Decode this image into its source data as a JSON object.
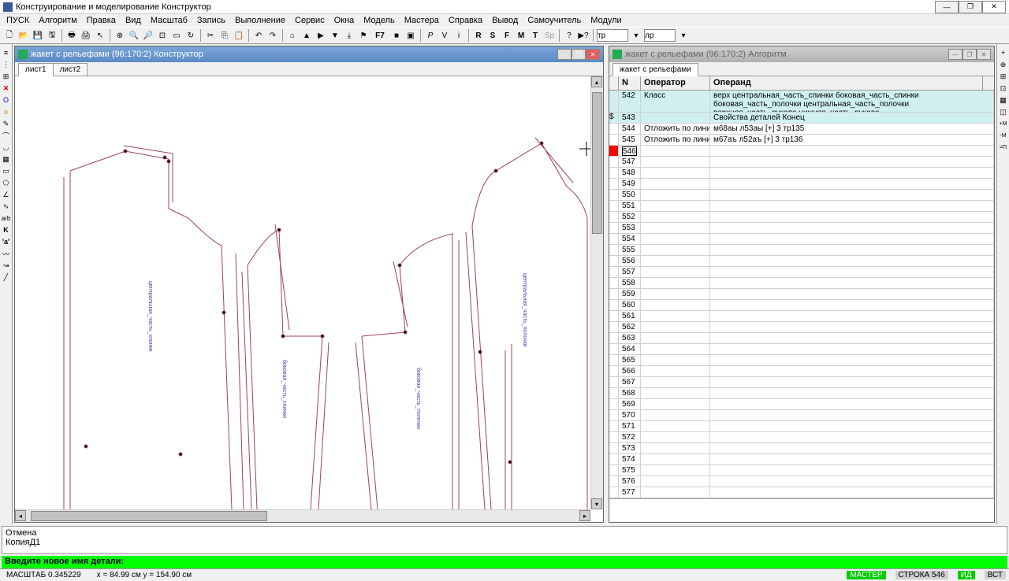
{
  "app": {
    "title": "Конструирование и моделирование  Конструктор"
  },
  "menu": [
    "ПУСК",
    "Алгоритм",
    "Правка",
    "Вид",
    "Масштаб",
    "Запись",
    "Выполнение",
    "Сервис",
    "Окна",
    "Модель",
    "Мастера",
    "Справка",
    "Вывод",
    "Самоучитель",
    "Модули"
  ],
  "toolbar_inputs": {
    "left": "тр",
    "right": "лр"
  },
  "left_panel": {
    "title": "жакет с рельефами (96:170:2) Конструктор",
    "tabs": [
      "лист1",
      "лист2"
    ],
    "active_tab": 0
  },
  "right_panel": {
    "title": "жакет с рельефами (96:170:2) Алгоритм",
    "tab": "жакет с рельефами",
    "columns": {
      "n": "N",
      "operator": "Оператор",
      "operand": "Операнд"
    },
    "rows": [
      {
        "n": "542",
        "op": "Класс",
        "operand": "верх центральная_часть_спинки боковая_часть_спинки боковая_часть_полочки центральная_часть_полочки верхняя_часть_рукава нижняя_часть_рукава",
        "hl": true
      },
      {
        "n": "543",
        "op": "",
        "operand": "Свойства деталей Конец",
        "hl": true,
        "marker": "$"
      },
      {
        "n": "544",
        "op": "Отложить по линии",
        "operand": "м68аы л53аы [+] 3 тр135"
      },
      {
        "n": "545",
        "op": "Отложить по линии",
        "operand": "м67аъ л52аъ [+] 3 тр136"
      },
      {
        "n": "546",
        "op": "",
        "operand": "",
        "current": true
      },
      {
        "n": "547"
      },
      {
        "n": "548"
      },
      {
        "n": "549"
      },
      {
        "n": "550"
      },
      {
        "n": "551"
      },
      {
        "n": "552"
      },
      {
        "n": "553"
      },
      {
        "n": "554"
      },
      {
        "n": "555"
      },
      {
        "n": "556"
      },
      {
        "n": "557"
      },
      {
        "n": "558"
      },
      {
        "n": "559"
      },
      {
        "n": "560"
      },
      {
        "n": "561"
      },
      {
        "n": "562"
      },
      {
        "n": "563"
      },
      {
        "n": "564"
      },
      {
        "n": "565"
      },
      {
        "n": "566"
      },
      {
        "n": "567"
      },
      {
        "n": "568"
      },
      {
        "n": "569"
      },
      {
        "n": "570"
      },
      {
        "n": "571"
      },
      {
        "n": "572"
      },
      {
        "n": "573"
      },
      {
        "n": "574"
      },
      {
        "n": "575"
      },
      {
        "n": "576"
      },
      {
        "n": "577"
      }
    ]
  },
  "log": {
    "line1": "Отмена",
    "line2": "КопияД1"
  },
  "prompt": "Введите новое имя детали:",
  "status": {
    "scale": "МАСШТАБ 0.345229",
    "coords": "x = 84.99 см   y = 154.90 см",
    "master": "МАСТЕР",
    "row": "СТРОКА 546",
    "id": "ИД",
    "vst": "ВСТ"
  }
}
